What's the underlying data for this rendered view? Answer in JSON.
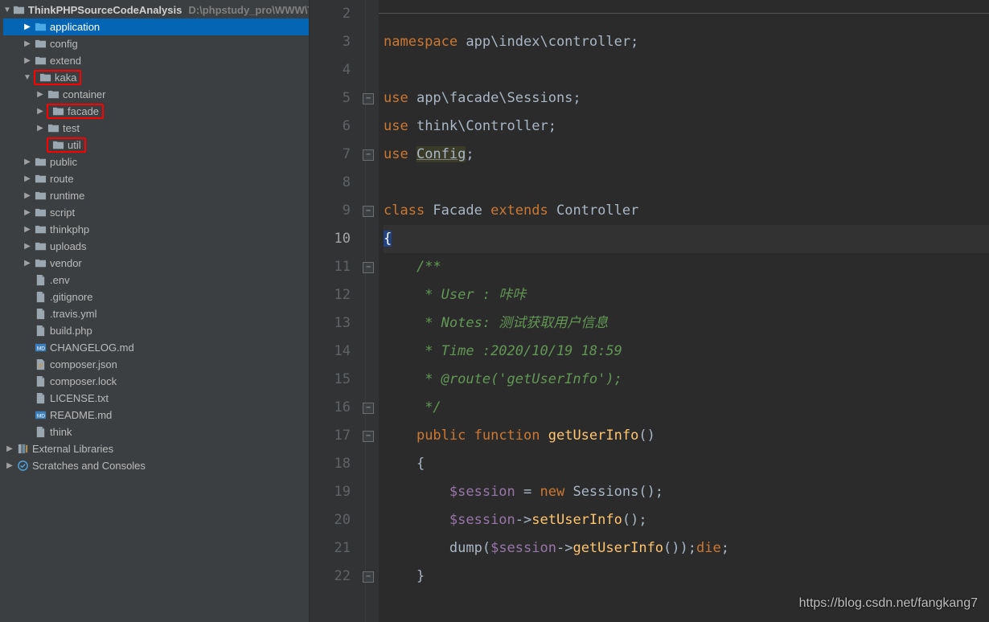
{
  "project": {
    "name": "ThinkPHPSourceCodeAnalysis",
    "path": "D:\\phpstudy_pro\\WWW\\Th"
  },
  "tree": [
    {
      "indent": 1,
      "arrow": "▶",
      "icon": "folder-sel",
      "label": "application",
      "selected": true
    },
    {
      "indent": 1,
      "arrow": "▶",
      "icon": "folder",
      "label": "config"
    },
    {
      "indent": 1,
      "arrow": "▶",
      "icon": "folder",
      "label": "extend"
    },
    {
      "indent": 1,
      "arrow": "▼",
      "icon": "folder",
      "label": "kaka",
      "boxed": true
    },
    {
      "indent": 2,
      "arrow": "▶",
      "icon": "folder",
      "label": "container"
    },
    {
      "indent": 2,
      "arrow": "▶",
      "icon": "folder",
      "label": "facade",
      "boxed": true
    },
    {
      "indent": 2,
      "arrow": "▶",
      "icon": "folder",
      "label": "test"
    },
    {
      "indent": 2,
      "arrow": "",
      "icon": "folder",
      "label": "util",
      "boxed": true
    },
    {
      "indent": 1,
      "arrow": "▶",
      "icon": "folder",
      "label": "public"
    },
    {
      "indent": 1,
      "arrow": "▶",
      "icon": "folder",
      "label": "route"
    },
    {
      "indent": 1,
      "arrow": "▶",
      "icon": "folder",
      "label": "runtime"
    },
    {
      "indent": 1,
      "arrow": "▶",
      "icon": "folder",
      "label": "script"
    },
    {
      "indent": 1,
      "arrow": "▶",
      "icon": "folder",
      "label": "thinkphp"
    },
    {
      "indent": 1,
      "arrow": "▶",
      "icon": "folder",
      "label": "uploads"
    },
    {
      "indent": 1,
      "arrow": "▶",
      "icon": "folder",
      "label": "vendor"
    },
    {
      "indent": 1,
      "arrow": "",
      "icon": "file",
      "label": ".env"
    },
    {
      "indent": 1,
      "arrow": "",
      "icon": "file",
      "label": ".gitignore"
    },
    {
      "indent": 1,
      "arrow": "",
      "icon": "file",
      "label": ".travis.yml"
    },
    {
      "indent": 1,
      "arrow": "",
      "icon": "file",
      "label": "build.php"
    },
    {
      "indent": 1,
      "arrow": "",
      "icon": "md",
      "label": "CHANGELOG.md"
    },
    {
      "indent": 1,
      "arrow": "",
      "icon": "json",
      "label": "composer.json"
    },
    {
      "indent": 1,
      "arrow": "",
      "icon": "file",
      "label": "composer.lock"
    },
    {
      "indent": 1,
      "arrow": "",
      "icon": "file",
      "label": "LICENSE.txt"
    },
    {
      "indent": 1,
      "arrow": "",
      "icon": "md",
      "label": "README.md"
    },
    {
      "indent": 1,
      "arrow": "",
      "icon": "file",
      "label": "think"
    }
  ],
  "libs": [
    {
      "arrow": "▶",
      "icon": "lib",
      "label": "External Libraries"
    },
    {
      "arrow": "▶",
      "icon": "scratch",
      "label": "Scratches and Consoles"
    }
  ],
  "code": {
    "lines": [
      {
        "n": 2,
        "tokens": []
      },
      {
        "n": 3,
        "tokens": [
          {
            "t": "kw",
            "v": "namespace "
          },
          {
            "t": "id",
            "v": "app\\index\\controller;"
          }
        ]
      },
      {
        "n": 4,
        "tokens": []
      },
      {
        "n": 5,
        "fold": true,
        "tokens": [
          {
            "t": "kw",
            "v": "use "
          },
          {
            "t": "id",
            "v": "app\\facade\\Sessions;"
          }
        ]
      },
      {
        "n": 6,
        "tokens": [
          {
            "t": "kw",
            "v": "use "
          },
          {
            "t": "id",
            "v": "think\\Controller;"
          }
        ]
      },
      {
        "n": 7,
        "fold": true,
        "tokens": [
          {
            "t": "kw",
            "v": "use "
          },
          {
            "t": "und",
            "v": "Config"
          },
          {
            "t": "id",
            "v": ";"
          }
        ]
      },
      {
        "n": 8,
        "tokens": []
      },
      {
        "n": 9,
        "fold": true,
        "tokens": [
          {
            "t": "kw",
            "v": "class "
          },
          {
            "t": "id",
            "v": "Facade "
          },
          {
            "t": "kw",
            "v": "extends "
          },
          {
            "t": "id",
            "v": "Controller"
          }
        ]
      },
      {
        "n": 10,
        "current": true,
        "tokens": [
          {
            "t": "brace",
            "v": "{"
          }
        ]
      },
      {
        "n": 11,
        "fold": true,
        "tokens": [
          {
            "t": "ind",
            "v": "    "
          },
          {
            "t": "cmt",
            "v": "/**"
          }
        ]
      },
      {
        "n": 12,
        "tokens": [
          {
            "t": "ind",
            "v": "    "
          },
          {
            "t": "cmt",
            "v": " * User : 咔咔"
          }
        ]
      },
      {
        "n": 13,
        "tokens": [
          {
            "t": "ind",
            "v": "    "
          },
          {
            "t": "cmt",
            "v": " * Notes: 测试获取用户信息"
          }
        ]
      },
      {
        "n": 14,
        "tokens": [
          {
            "t": "ind",
            "v": "    "
          },
          {
            "t": "cmt",
            "v": " * Time :2020/10/19 18:59"
          }
        ]
      },
      {
        "n": 15,
        "tokens": [
          {
            "t": "ind",
            "v": "    "
          },
          {
            "t": "cmt",
            "v": " * @route('getUserInfo');"
          }
        ]
      },
      {
        "n": 16,
        "fold": true,
        "tokens": [
          {
            "t": "ind",
            "v": "    "
          },
          {
            "t": "cmt",
            "v": " */"
          }
        ]
      },
      {
        "n": 17,
        "fold": true,
        "tokens": [
          {
            "t": "ind",
            "v": "    "
          },
          {
            "t": "kw",
            "v": "public "
          },
          {
            "t": "kw",
            "v": "function "
          },
          {
            "t": "fn",
            "v": "getUserInfo"
          },
          {
            "t": "id",
            "v": "()"
          }
        ]
      },
      {
        "n": 18,
        "tokens": [
          {
            "t": "ind",
            "v": "    "
          },
          {
            "t": "id",
            "v": "{"
          }
        ]
      },
      {
        "n": 19,
        "tokens": [
          {
            "t": "ind",
            "v": "        "
          },
          {
            "t": "var",
            "v": "$session"
          },
          {
            "t": "id",
            "v": " = "
          },
          {
            "t": "kw",
            "v": "new "
          },
          {
            "t": "id",
            "v": "Sessions();"
          }
        ]
      },
      {
        "n": 20,
        "tokens": [
          {
            "t": "ind",
            "v": "        "
          },
          {
            "t": "var",
            "v": "$session"
          },
          {
            "t": "id",
            "v": "->"
          },
          {
            "t": "fn",
            "v": "setUserInfo"
          },
          {
            "t": "id",
            "v": "();"
          }
        ]
      },
      {
        "n": 21,
        "tokens": [
          {
            "t": "ind",
            "v": "        "
          },
          {
            "t": "id",
            "v": "dump("
          },
          {
            "t": "var",
            "v": "$session"
          },
          {
            "t": "id",
            "v": "->"
          },
          {
            "t": "fn",
            "v": "getUserInfo"
          },
          {
            "t": "id",
            "v": "());"
          },
          {
            "t": "kw",
            "v": "die"
          },
          {
            "t": "id",
            "v": ";"
          }
        ]
      },
      {
        "n": 22,
        "fold": true,
        "tokens": [
          {
            "t": "ind",
            "v": "    "
          },
          {
            "t": "id",
            "v": "}"
          }
        ]
      }
    ]
  },
  "watermark": "https://blog.csdn.net/fangkang7"
}
